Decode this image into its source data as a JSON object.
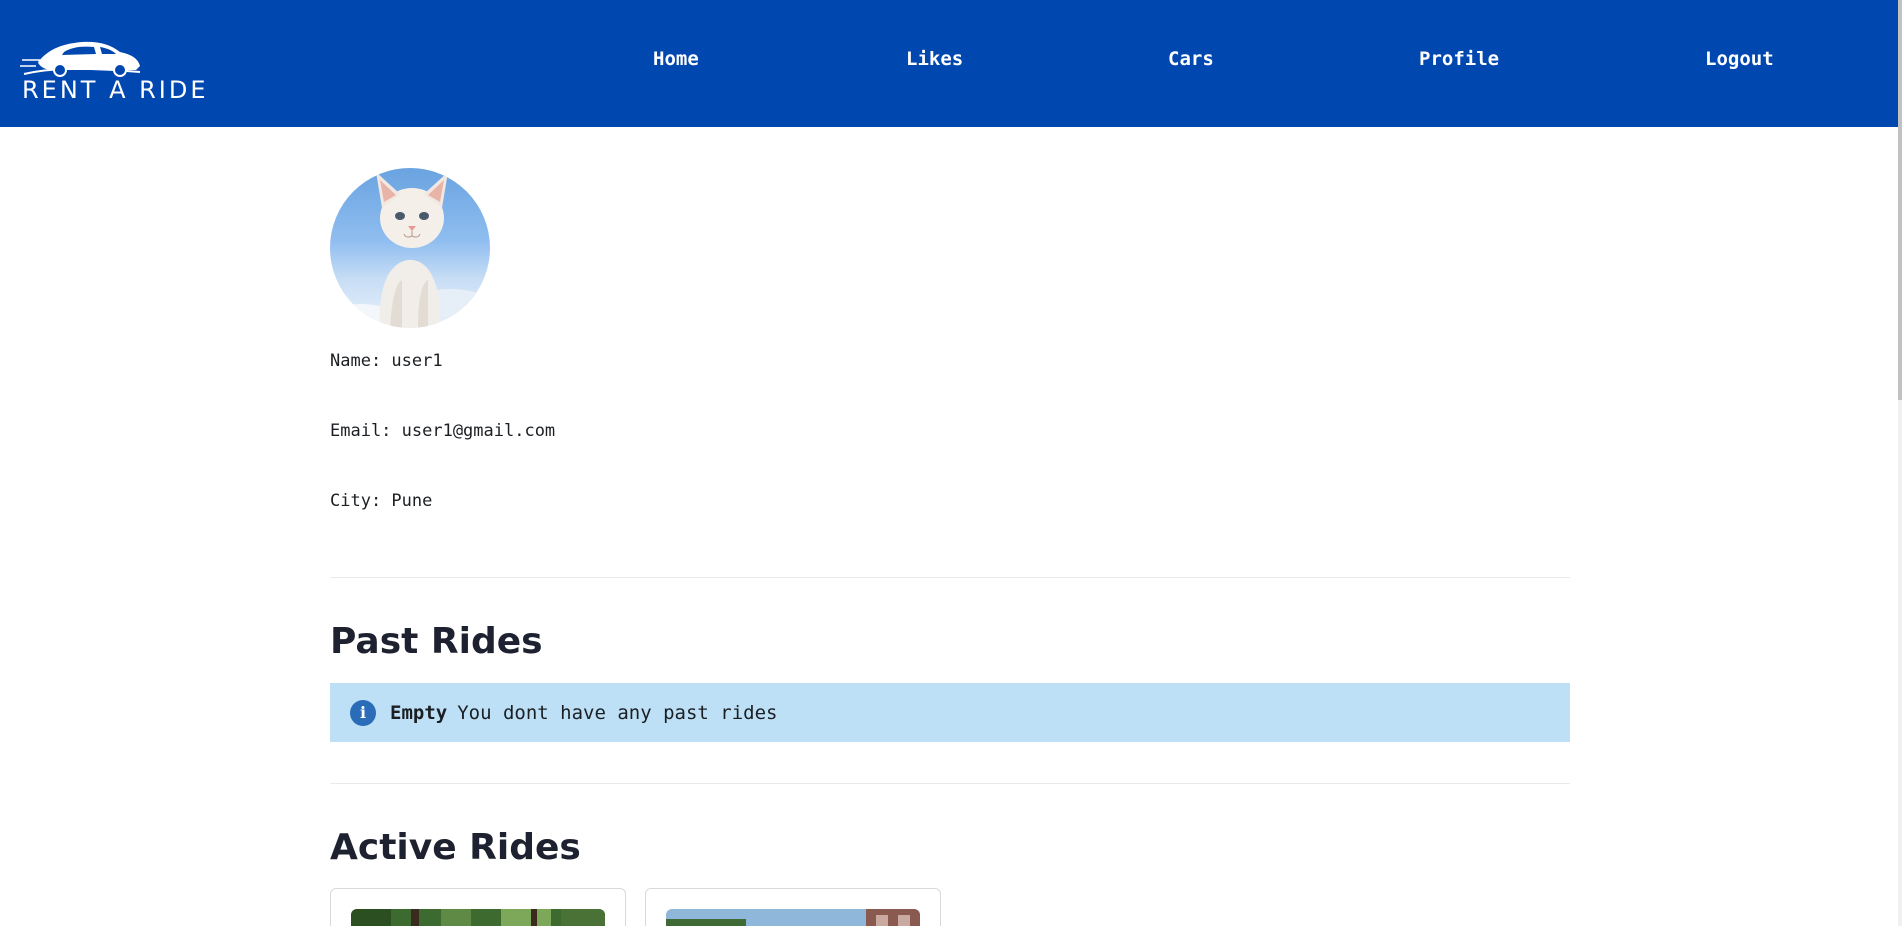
{
  "brand": {
    "logo_text": "RENT A RIDE"
  },
  "nav": {
    "home": "Home",
    "likes": "Likes",
    "cars": "Cars",
    "profile": "Profile",
    "logout": "Logout"
  },
  "profile": {
    "avatar_icon": "cat-photo",
    "name_label": "Name: user1",
    "email_label": "Email: user1@gmail.com",
    "city_label": "City: Pune"
  },
  "past_rides": {
    "title": "Past Rides",
    "alert_strong": "Empty",
    "alert_text": "You dont have any past rides",
    "alert_icon": "info-icon"
  },
  "active_rides": {
    "title": "Active Rides"
  },
  "colors": {
    "header": "#0048b0",
    "alert_bg": "#bde0f6",
    "info_icon": "#2b6cb8"
  }
}
